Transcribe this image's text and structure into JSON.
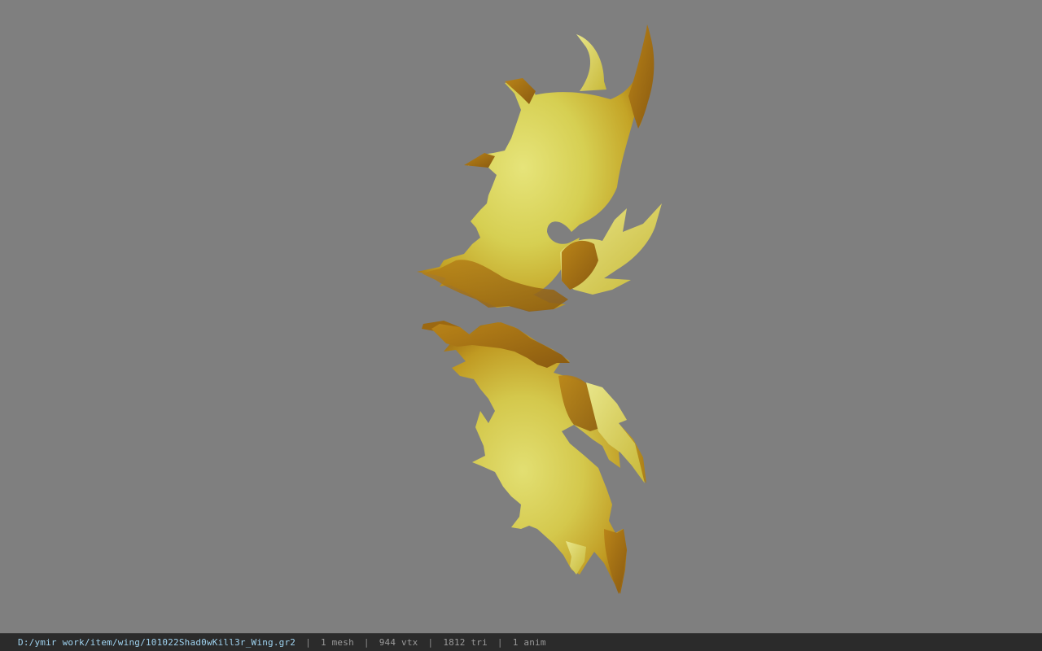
{
  "viewer": {
    "background_color": "#7f7f7f",
    "model": {
      "name": "wing-mesh",
      "colors": {
        "light": "#d9d565",
        "mid": "#c9b22a",
        "dark": "#a8700f",
        "shadow": "#8a5a10"
      }
    }
  },
  "statusbar": {
    "file_path": "D:/ymir work/item/wing/101022Shad0wKill3r_Wing.gr2",
    "separator": "|",
    "mesh_count": "1 mesh",
    "vertex_count": "944 vtx",
    "triangle_count": "1812 tri",
    "anim_count": "1 anim"
  }
}
